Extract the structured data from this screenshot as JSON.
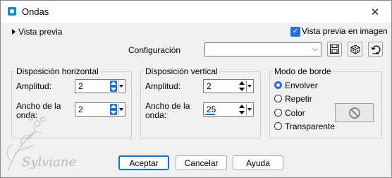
{
  "window": {
    "title": "Ondas",
    "close_glyph": "✕"
  },
  "top": {
    "preview_toggle": "Vista previa",
    "preview_checkbox": {
      "label": "Vista previa en imagen",
      "checked": true
    },
    "configuration_label": "Configuración",
    "configuration_value": ""
  },
  "horizontal": {
    "title": "Disposición horizontal",
    "amplitude_label": "Amplitud:",
    "amplitude_value": "2",
    "wavelength_label_1": "Ancho de la",
    "wavelength_label_2": "onda:",
    "wavelength_value": "2"
  },
  "vertical": {
    "title": "Disposición vertical",
    "amplitude_label": "Amplitud:",
    "amplitude_value": "2",
    "wavelength_label_1": "Ancho de la",
    "wavelength_label_2": "onda:",
    "wavelength_value": "25"
  },
  "edge": {
    "title": "Modo de borde",
    "options": [
      "Envolver",
      "Repetir",
      "Color",
      "Transparente"
    ],
    "selected": "Envolver"
  },
  "buttons": {
    "accept": "Aceptar",
    "cancel": "Cancelar",
    "help": "Ayuda"
  },
  "watermark": "Sylviane",
  "colors": {
    "accent": "#1f6fd0",
    "icon_blue": "#1e88c7"
  }
}
